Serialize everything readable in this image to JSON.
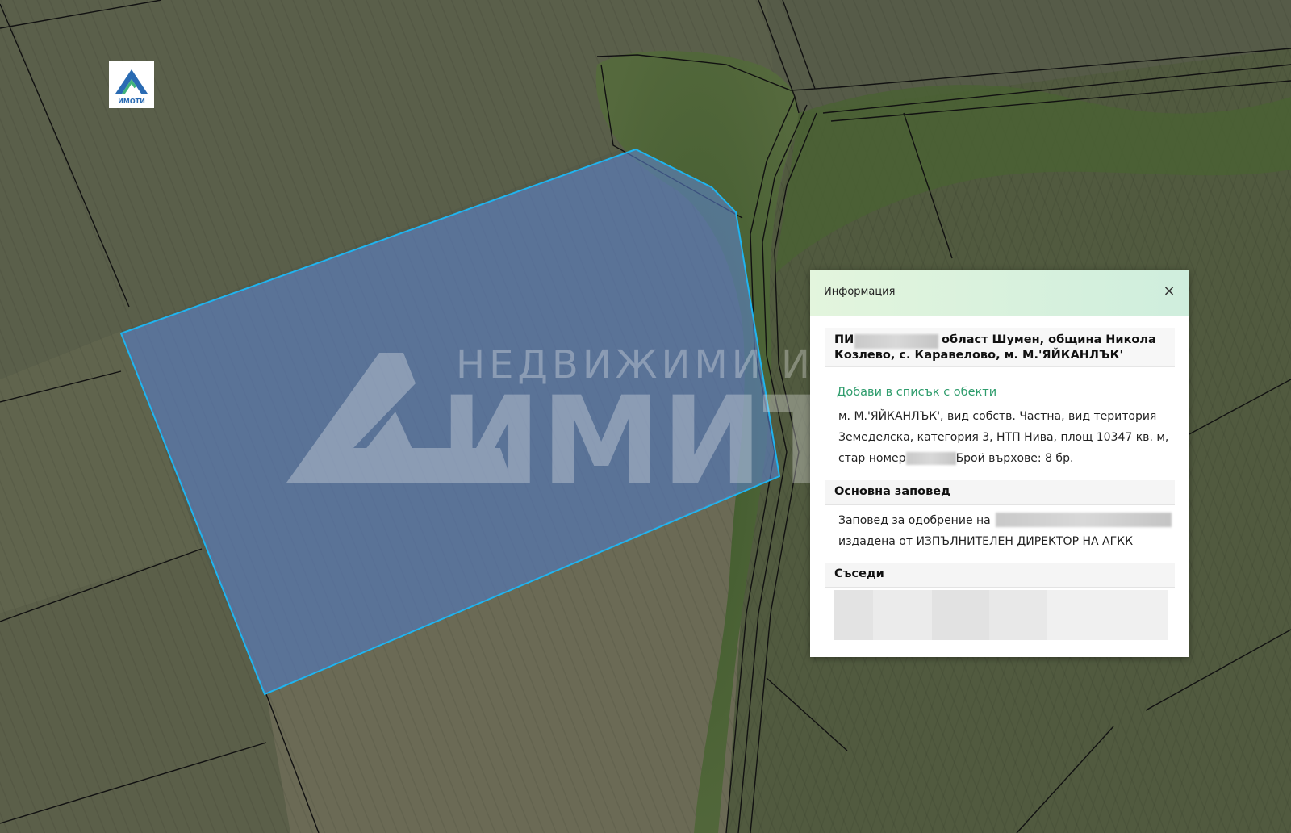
{
  "logo": {
    "brand_text": "ИМОТИ",
    "icon": "a-mountain-logo-icon"
  },
  "watermark": {
    "top_text": "НЕДВИЖИМИ ИМОТИ",
    "main_text": "ИМИТР"
  },
  "popup": {
    "title": "Информация",
    "close_label": "×",
    "parcel_prefix": "ПИ",
    "parcel_line1": "област Шумен, община Никола",
    "parcel_line2": "Козлево, с. Каравелово, м. М.'ЯЙКАНЛЪК'",
    "add_to_list": "Добави в списък с обекти",
    "desc_line1": "м. М.'ЯЙКАНЛЪК', вид собств. Частна, вид територия",
    "desc_line2": "Земеделска, категория 3, НТП Нива, площ 10347 кв. м,",
    "desc_line3_a": "стар номер",
    "desc_line3_b": "Брой върхове: 8 бр.",
    "main_order_heading": "Основна заповед",
    "order_line1": "Заповед за одобрение на",
    "order_line2": "издадена от ИЗПЪЛНИТЕЛЕН ДИРЕКТОР НА АГКК",
    "neighbors_heading": "Съседи"
  },
  "colors": {
    "parcel_stroke": "#1fb4f0",
    "parcel_fill": "#5f86d8",
    "link": "#2e9c6c",
    "header_gradient_start": "#e3f5dd",
    "header_gradient_end": "#cfeedd"
  }
}
